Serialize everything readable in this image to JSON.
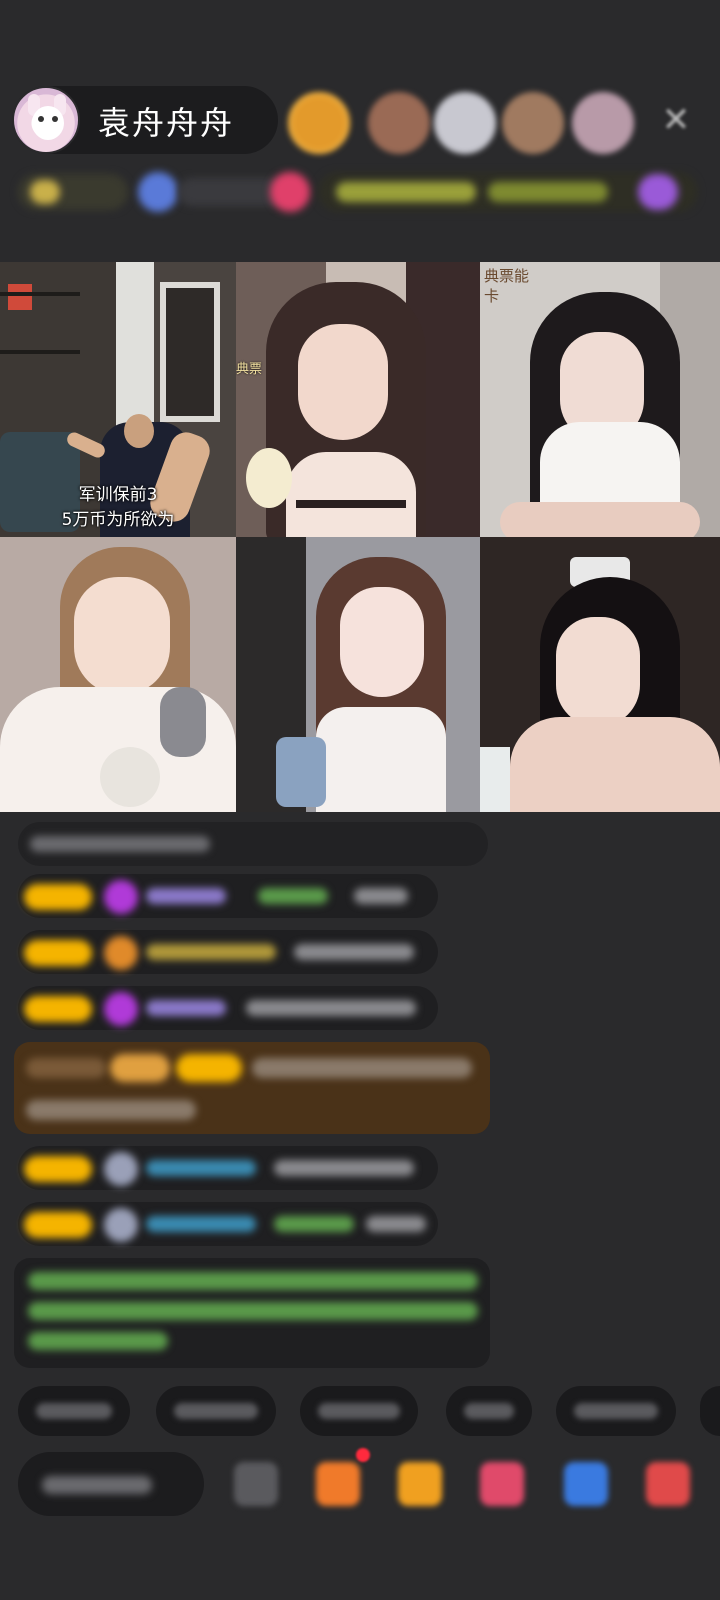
{
  "header": {
    "host_name": "袁舟舟舟",
    "close_icon": "close-icon"
  },
  "grid": {
    "tiles": [
      {
        "caption_line1": "军训保前3",
        "caption_line2": "5万币为所欲为"
      },
      {
        "side_label": "典票"
      },
      {
        "side_label": "典票能卡"
      },
      {},
      {},
      {}
    ]
  },
  "colors": {
    "background": "#2a2a2c",
    "level_badge": "#f5b400",
    "notice_bg": "#5a3a18",
    "green_text": "#7bd36b"
  }
}
